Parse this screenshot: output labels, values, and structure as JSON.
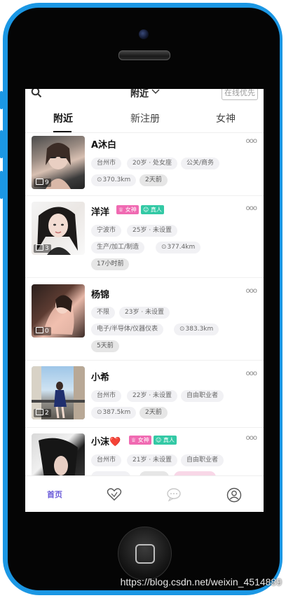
{
  "topbar": {
    "location_label": "附近",
    "online_first_label": "在线优先"
  },
  "tabs": [
    {
      "label": "附近",
      "active": true
    },
    {
      "label": "新注册",
      "active": false
    },
    {
      "label": "女神",
      "active": false
    }
  ],
  "profiles": [
    {
      "name": "A沐白",
      "photo_count": "9",
      "badges": [],
      "tags": [
        "台州市",
        "20岁 · 处女座",
        "公关/商务"
      ],
      "distance": "370.3km",
      "last_active": "2天前"
    },
    {
      "name": "洋洋",
      "photo_count": "3",
      "badges": [
        "女神",
        "真人"
      ],
      "tags": [
        "宁波市",
        "25岁 · 未设置",
        "生产/加工/制造"
      ],
      "distance": "377.4km",
      "last_active": "17小时前"
    },
    {
      "name": "杨锦",
      "photo_count": "0",
      "badges": [],
      "tags": [
        "不限",
        "23岁 · 未设置",
        "电子/半导体/仪器仪表"
      ],
      "distance": "383.3km",
      "last_active": "5天前"
    },
    {
      "name": "小希",
      "photo_count": "2",
      "badges": [],
      "tags": [
        "台州市",
        "22岁 · 未设置",
        "自由职业者"
      ],
      "distance": "387.5km",
      "last_active": "2天前"
    },
    {
      "name": "小沫",
      "name_emoji": "❤️",
      "photo_count": "",
      "badges": [
        "女神",
        "真人"
      ],
      "tags": [
        "台州市",
        "21岁 · 未设置",
        "自由职业者"
      ],
      "distance": "",
      "last_active": ""
    }
  ],
  "bottom_nav": {
    "home_label": "首页",
    "items": [
      "home",
      "match-heart-icon",
      "message-bubble-icon",
      "profile-icon"
    ]
  },
  "watermark": "https://blog.csdn.net/weixin_4514889",
  "colors": {
    "frame": "#1b97e4",
    "accent": "#6a5bd9",
    "goddess_badge": "#f06ab2",
    "real_badge": "#33c9a5"
  }
}
